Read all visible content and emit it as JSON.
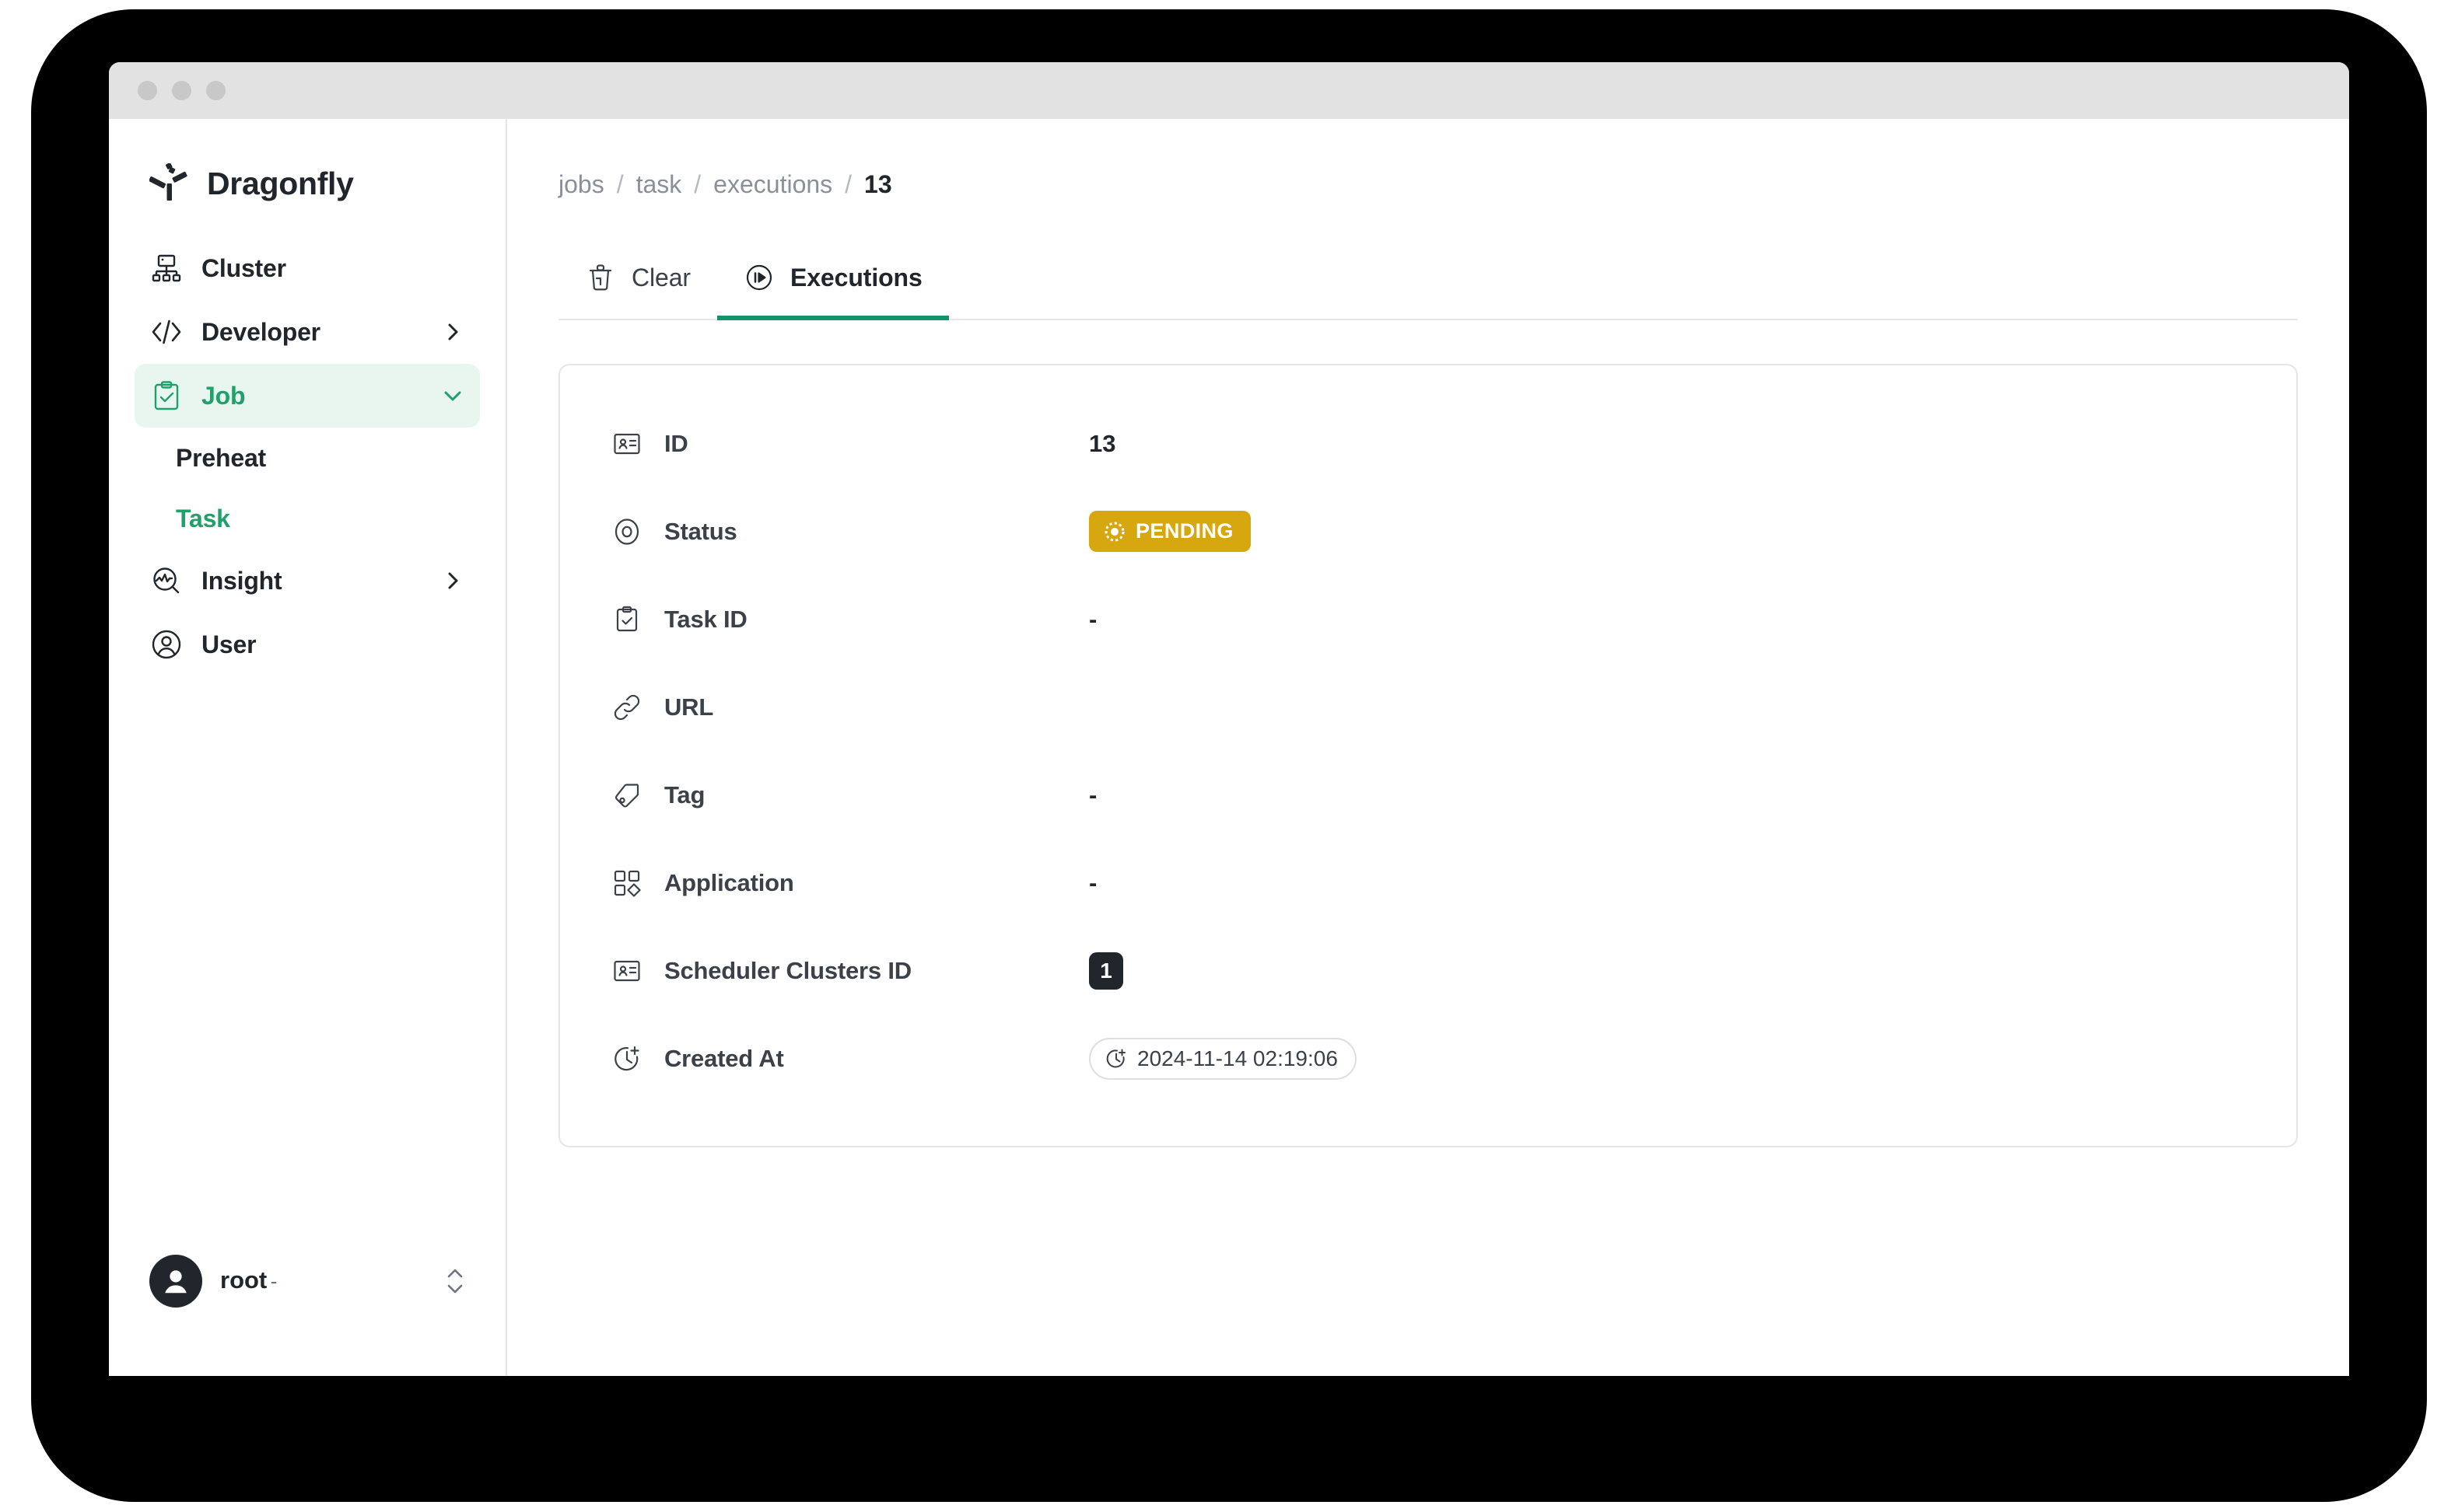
{
  "window": {
    "traffic_lights": [
      "close",
      "minimize",
      "maximize"
    ]
  },
  "sidebar": {
    "brand": {
      "name": "Dragonfly",
      "logo_icon": "dragonfly-logo-icon"
    },
    "items": [
      {
        "label": "Cluster",
        "icon": "cluster-icon",
        "chevron": "none",
        "active": false
      },
      {
        "label": "Developer",
        "icon": "code-brackets-icon",
        "chevron": "chevron-right-icon",
        "active": false
      },
      {
        "label": "Job",
        "icon": "clipboard-check-icon",
        "chevron": "chevron-down-icon",
        "active": true
      },
      {
        "label": "Insight",
        "icon": "insight-magnifier-icon",
        "chevron": "chevron-right-icon",
        "active": false
      },
      {
        "label": "User",
        "icon": "user-circle-icon",
        "chevron": "none",
        "active": false
      }
    ],
    "job_children": [
      {
        "label": "Preheat",
        "active": false
      },
      {
        "label": "Task",
        "active": true
      }
    ],
    "user": {
      "name": "root",
      "subtitle": "-",
      "avatar_icon": "avatar-person-icon",
      "toggle_icon": "chevron-up-down-icon"
    }
  },
  "breadcrumb": {
    "items": [
      "jobs",
      "task",
      "executions",
      "13"
    ],
    "separator": "/"
  },
  "tabs": [
    {
      "label": "Clear",
      "icon": "trash-icon",
      "selected": false
    },
    {
      "label": "Executions",
      "icon": "play-circle-icon",
      "selected": true
    }
  ],
  "detail": {
    "rows": [
      {
        "label": "ID",
        "icon": "id-card-icon",
        "value": "13",
        "value_type": "text"
      },
      {
        "label": "Status",
        "icon": "circle-target-icon",
        "value": "PENDING",
        "value_type": "status-badge",
        "badge_icon": "pending-spinner-icon",
        "badge_color": "#d6a70f"
      },
      {
        "label": "Task ID",
        "icon": "clipboard-check-icon",
        "value": "-",
        "value_type": "text"
      },
      {
        "label": "URL",
        "icon": "link-icon",
        "value": "",
        "value_type": "skeleton"
      },
      {
        "label": "Tag",
        "icon": "tag-icon",
        "value": "-",
        "value_type": "text"
      },
      {
        "label": "Application",
        "icon": "apps-grid-icon",
        "value": "-",
        "value_type": "text"
      },
      {
        "label": "Scheduler Clusters ID",
        "icon": "id-card-icon",
        "value": "1",
        "value_type": "chip-dark"
      },
      {
        "label": "Created At",
        "icon": "clock-plus-icon",
        "value": "2024-11-14 02:19:06",
        "value_type": "chip-outline",
        "chip_icon": "clock-plus-icon"
      }
    ]
  },
  "colors": {
    "accent_green": "#22a06b",
    "tab_underline": "#12936a",
    "active_nav_bg": "#e9f6ef",
    "status_pending": "#d6a70f",
    "dark": "#21262c",
    "muted": "#8a9099",
    "border": "#e6e6e6",
    "skeleton": "#d9d9d9"
  }
}
